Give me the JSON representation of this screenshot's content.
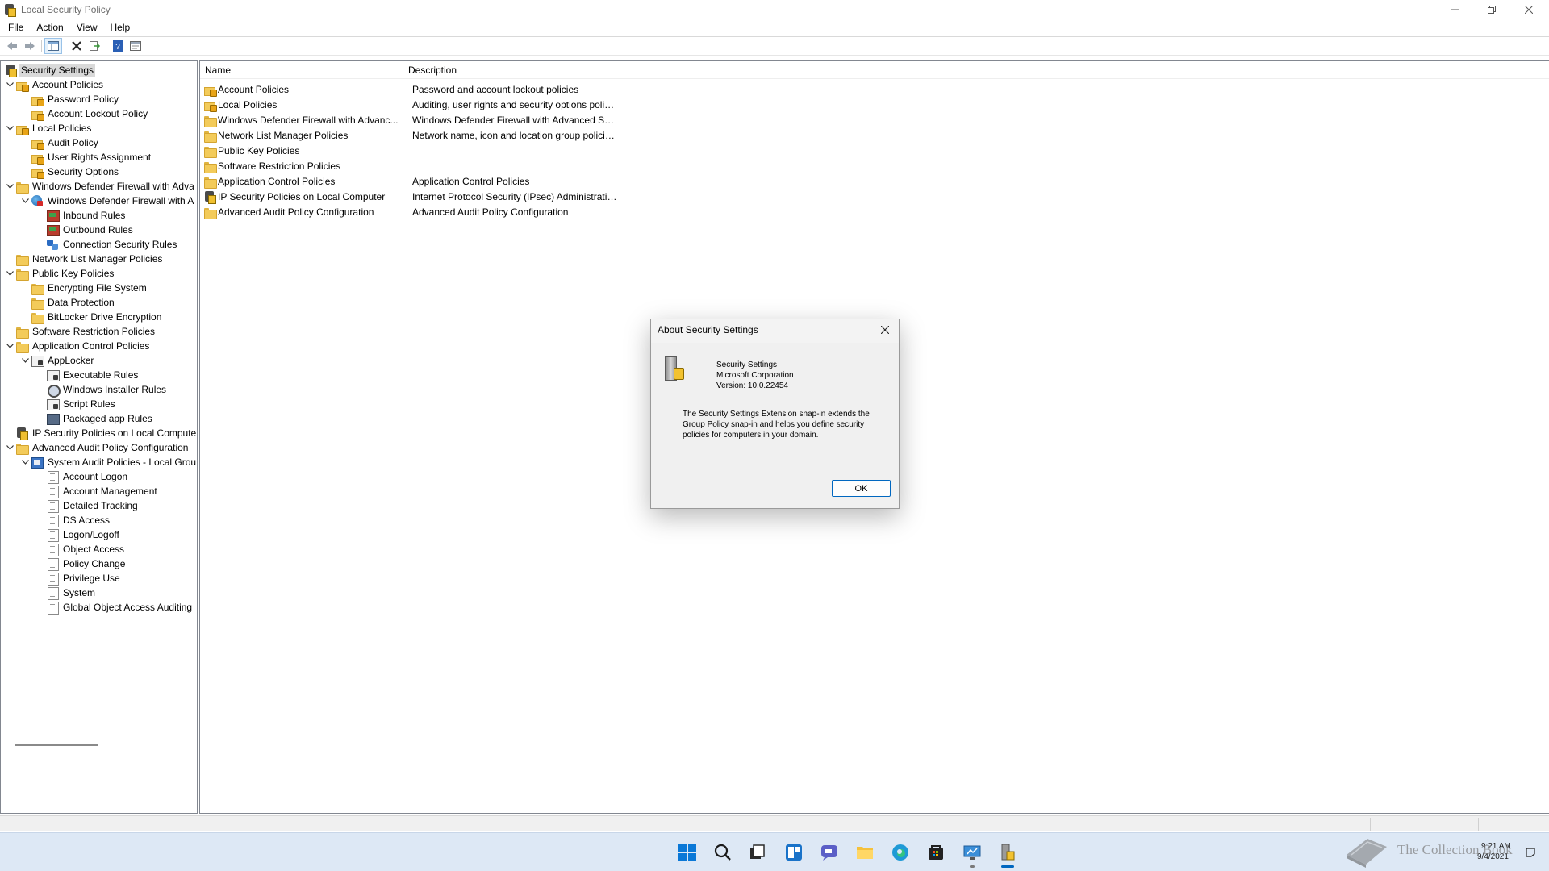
{
  "window": {
    "title": "Local Security Policy"
  },
  "menu": [
    "File",
    "Action",
    "View",
    "Help"
  ],
  "toolbar": {
    "buttons": [
      "back-icon",
      "forward-icon",
      "show-hide-tree-icon",
      "delete-icon",
      "export-list-icon",
      "help-icon",
      "properties-icon"
    ]
  },
  "tree": [
    {
      "label": "Security Settings",
      "level": 0,
      "expander": "",
      "icon": "lockshield",
      "selected": true
    },
    {
      "label": "Account Policies",
      "level": 1,
      "expander": "open",
      "icon": "lockfolder"
    },
    {
      "label": "Password Policy",
      "level": 2,
      "expander": "",
      "icon": "lockfolder"
    },
    {
      "label": "Account Lockout Policy",
      "level": 2,
      "expander": "",
      "icon": "lockfolder"
    },
    {
      "label": "Local Policies",
      "level": 1,
      "expander": "open",
      "icon": "lockfolder"
    },
    {
      "label": "Audit Policy",
      "level": 2,
      "expander": "",
      "icon": "lockfolder"
    },
    {
      "label": "User Rights Assignment",
      "level": 2,
      "expander": "",
      "icon": "lockfolder"
    },
    {
      "label": "Security Options",
      "level": 2,
      "expander": "",
      "icon": "lockfolder"
    },
    {
      "label": "Windows Defender Firewall with Adva",
      "level": 1,
      "expander": "open",
      "icon": "folder"
    },
    {
      "label": "Windows Defender Firewall with A",
      "level": 2,
      "expander": "open",
      "icon": "globe"
    },
    {
      "label": "Inbound Rules",
      "level": 3,
      "expander": "",
      "icon": "rule"
    },
    {
      "label": "Outbound Rules",
      "level": 3,
      "expander": "",
      "icon": "rule"
    },
    {
      "label": "Connection Security Rules",
      "level": 3,
      "expander": "",
      "icon": "conn"
    },
    {
      "label": "Network List Manager Policies",
      "level": 1,
      "expander": "",
      "icon": "folder"
    },
    {
      "label": "Public Key Policies",
      "level": 1,
      "expander": "open",
      "icon": "folder"
    },
    {
      "label": "Encrypting File System",
      "level": 2,
      "expander": "",
      "icon": "folder"
    },
    {
      "label": "Data Protection",
      "level": 2,
      "expander": "",
      "icon": "folder"
    },
    {
      "label": "BitLocker Drive Encryption",
      "level": 2,
      "expander": "",
      "icon": "folder"
    },
    {
      "label": "Software Restriction Policies",
      "level": 1,
      "expander": "",
      "icon": "folder"
    },
    {
      "label": "Application Control Policies",
      "level": 1,
      "expander": "open",
      "icon": "folder"
    },
    {
      "label": "AppLocker",
      "level": 2,
      "expander": "open",
      "icon": "applocker"
    },
    {
      "label": "Executable Rules",
      "level": 3,
      "expander": "",
      "icon": "applocker"
    },
    {
      "label": "Windows Installer Rules",
      "level": 3,
      "expander": "",
      "icon": "installer"
    },
    {
      "label": "Script Rules",
      "level": 3,
      "expander": "",
      "icon": "applocker"
    },
    {
      "label": "Packaged app Rules",
      "level": 3,
      "expander": "",
      "icon": "pkg"
    },
    {
      "label": "IP Security Policies on Local Compute",
      "level": 1,
      "expander": "",
      "icon": "lockshield"
    },
    {
      "label": "Advanced Audit Policy Configuration",
      "level": 1,
      "expander": "open",
      "icon": "folder"
    },
    {
      "label": "System Audit Policies - Local Grou",
      "level": 2,
      "expander": "open",
      "icon": "audit"
    },
    {
      "label": "Account Logon",
      "level": 3,
      "expander": "",
      "icon": "sheet"
    },
    {
      "label": "Account Management",
      "level": 3,
      "expander": "",
      "icon": "sheet"
    },
    {
      "label": "Detailed Tracking",
      "level": 3,
      "expander": "",
      "icon": "sheet"
    },
    {
      "label": "DS Access",
      "level": 3,
      "expander": "",
      "icon": "sheet"
    },
    {
      "label": "Logon/Logoff",
      "level": 3,
      "expander": "",
      "icon": "sheet"
    },
    {
      "label": "Object Access",
      "level": 3,
      "expander": "",
      "icon": "sheet"
    },
    {
      "label": "Policy Change",
      "level": 3,
      "expander": "",
      "icon": "sheet"
    },
    {
      "label": "Privilege Use",
      "level": 3,
      "expander": "",
      "icon": "sheet"
    },
    {
      "label": "System",
      "level": 3,
      "expander": "",
      "icon": "sheet"
    },
    {
      "label": "Global Object Access Auditing",
      "level": 3,
      "expander": "",
      "icon": "sheet"
    }
  ],
  "list": {
    "columns": [
      "Name",
      "Description"
    ],
    "rows": [
      {
        "name": "Account Policies",
        "description": "Password and account lockout policies",
        "icon": "lockfolder"
      },
      {
        "name": "Local Policies",
        "description": "Auditing, user rights and security options polici...",
        "icon": "lockfolder"
      },
      {
        "name": "Windows Defender Firewall with Advanc...",
        "description": "Windows Defender Firewall with Advanced Sec...",
        "icon": "folder"
      },
      {
        "name": "Network List Manager Policies",
        "description": "Network name, icon and location group policies.",
        "icon": "folder"
      },
      {
        "name": "Public Key Policies",
        "description": "",
        "icon": "folder"
      },
      {
        "name": "Software Restriction Policies",
        "description": "",
        "icon": "folder"
      },
      {
        "name": "Application Control Policies",
        "description": "Application Control Policies",
        "icon": "folder"
      },
      {
        "name": "IP Security Policies on Local Computer",
        "description": "Internet Protocol Security (IPsec) Administratio...",
        "icon": "lockshield"
      },
      {
        "name": "Advanced Audit Policy Configuration",
        "description": "Advanced Audit Policy Configuration",
        "icon": "folder"
      }
    ]
  },
  "dialog": {
    "title": "About Security Settings",
    "product": "Security Settings",
    "company": "Microsoft Corporation",
    "version": "Version: 10.0.22454",
    "description": "The Security Settings Extension snap-in extends the Group Policy snap-in and helps you define security policies for computers in your domain.",
    "ok_label": "OK"
  },
  "taskbar": {
    "apps": [
      "start-icon",
      "search-icon",
      "task-view-icon",
      "widgets-icon",
      "chat-icon",
      "file-explorer-icon",
      "edge-icon",
      "store-icon",
      "remote-desktop-icon",
      "local-security-policy-icon"
    ],
    "time": "9:21 AM",
    "date": "9/4/2021"
  },
  "watermark": {
    "text": "The Collection Book"
  }
}
